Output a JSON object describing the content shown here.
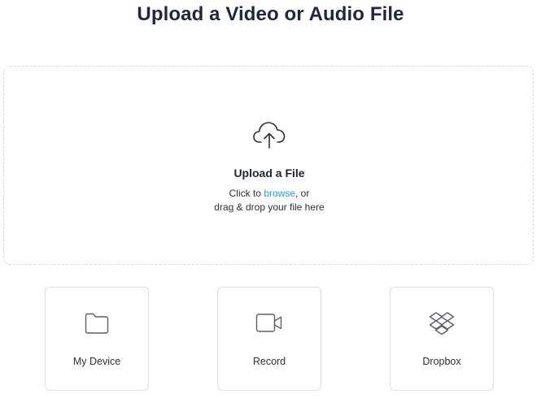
{
  "page": {
    "title": "Upload a Video or Audio File"
  },
  "dropzone": {
    "icon": "cloud-upload-icon",
    "heading": "Upload a File",
    "line1_prefix": "Click to ",
    "browse_link": "browse",
    "line1_suffix": ", or",
    "line2": "drag & drop your file here"
  },
  "sources": [
    {
      "label": "My Device",
      "icon": "folder-icon"
    },
    {
      "label": "Record",
      "icon": "video-camera-icon"
    },
    {
      "label": "Dropbox",
      "icon": "dropbox-icon"
    }
  ],
  "colors": {
    "link": "#1aa2e6",
    "title": "#1f2640",
    "border": "#dcdfe4",
    "icon": "#5a5f6a"
  }
}
